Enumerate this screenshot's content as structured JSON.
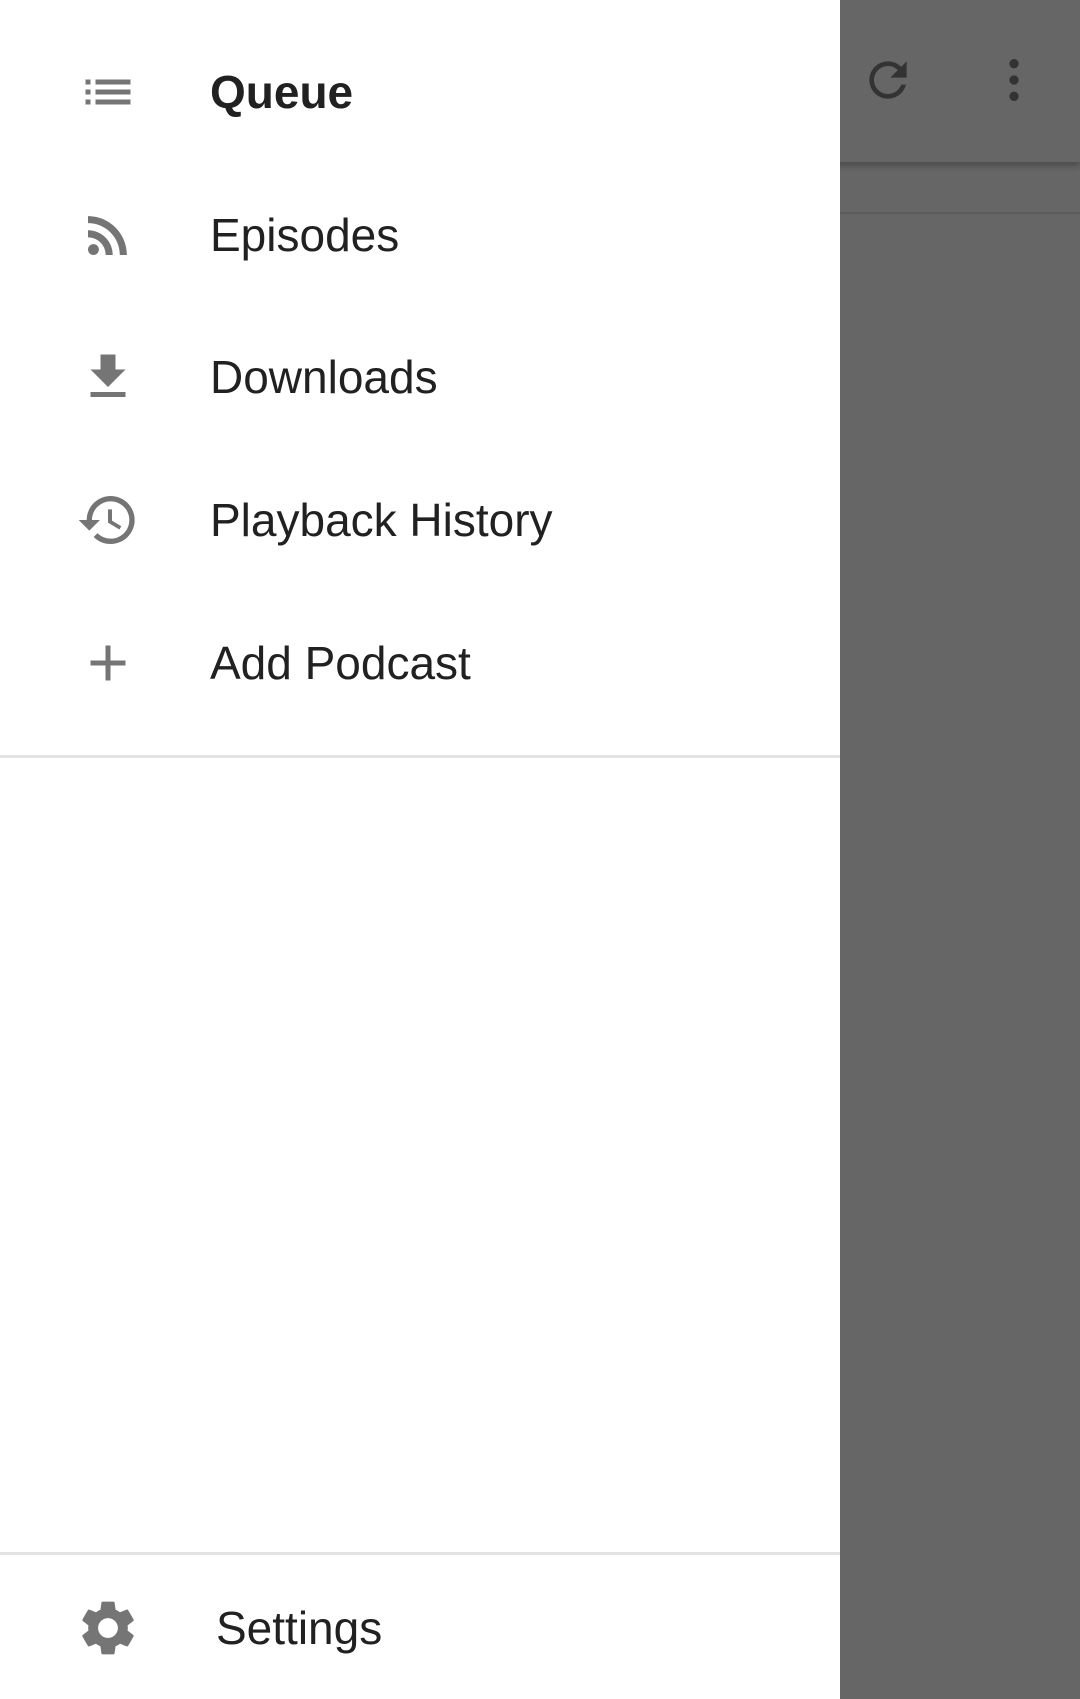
{
  "background": {
    "toolbar": {
      "refresh_icon": "refresh-icon",
      "more_icon": "more-vert-icon"
    },
    "scrim_color": "#666666"
  },
  "drawer": {
    "items": [
      {
        "label": "Queue",
        "icon": "queue-list-icon",
        "active": true
      },
      {
        "label": "Episodes",
        "icon": "rss-feed-icon",
        "active": false
      },
      {
        "label": "Downloads",
        "icon": "download-icon",
        "active": false
      },
      {
        "label": "Playback History",
        "icon": "history-icon",
        "active": false
      },
      {
        "label": "Add Podcast",
        "icon": "add-icon",
        "active": false
      }
    ],
    "footer": {
      "settings_label": "Settings",
      "settings_icon": "gear-icon"
    }
  },
  "colors": {
    "icon_gray": "#757575",
    "text_primary": "#212121",
    "divider": "#e3e3e3",
    "scrim": "#666666"
  }
}
